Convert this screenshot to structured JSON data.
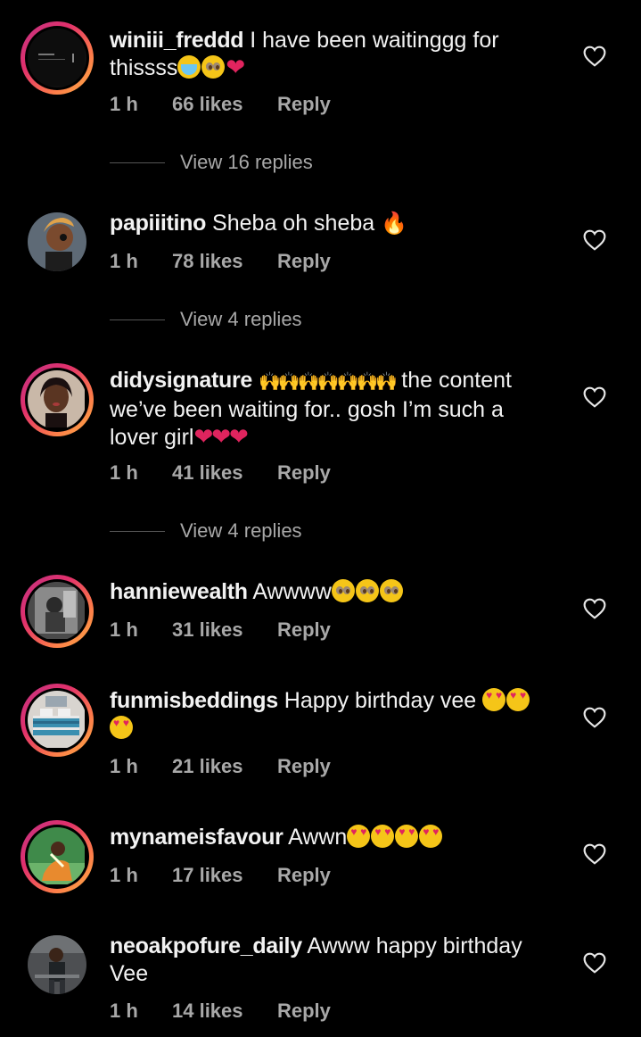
{
  "comments": [
    {
      "username": "winiii_freddd",
      "text": " I have been waitinggg for thissss",
      "emoji": [
        "sob-emoji",
        "pleading-face-emoji",
        "red-heart-emoji"
      ],
      "time": "1 h",
      "likes": "66 likes",
      "reply": "Reply",
      "view_replies": "View 16 replies"
    },
    {
      "username": "papiiitino",
      "text": " Sheba oh sheba ",
      "emoji": [
        "fire-emoji"
      ],
      "time": "1 h",
      "likes": "78 likes",
      "reply": "Reply",
      "view_replies": "View 4 replies"
    },
    {
      "username": "didysignature",
      "text_before": " ",
      "text": " the content we’ve been waiting for.. gosh I’m such a lover girl",
      "emoji": [
        "raising-hands-emoji",
        "red-heart-emoji"
      ],
      "time": "1 h",
      "likes": "41 likes",
      "reply": "Reply",
      "view_replies": "View 4 replies"
    },
    {
      "username": "hanniewealth",
      "text": " Awwww",
      "emoji": [
        "pleading-face-emoji"
      ],
      "time": "1 h",
      "likes": "31 likes",
      "reply": "Reply"
    },
    {
      "username": "funmisbeddings",
      "text": " Happy birthday vee ",
      "emoji": [
        "heart-eyes-emoji"
      ],
      "time": "1 h",
      "likes": "21 likes",
      "reply": "Reply"
    },
    {
      "username": "mynameisfavour",
      "text": " Awwn",
      "emoji": [
        "heart-eyes-emoji"
      ],
      "time": "1 h",
      "likes": "17 likes",
      "reply": "Reply"
    },
    {
      "username": "neoakpofure_daily",
      "text": " Awww happy birthday Vee",
      "time": "1 h",
      "likes": "14 likes",
      "reply": "Reply"
    }
  ],
  "colors": {
    "background": "#000000",
    "text": "#f2f2f2",
    "meta": "#a8a8a8",
    "story_ring_start": "#c13584",
    "story_ring_end": "#fcaf45"
  },
  "icons": {
    "like": "heart-outline-icon"
  }
}
